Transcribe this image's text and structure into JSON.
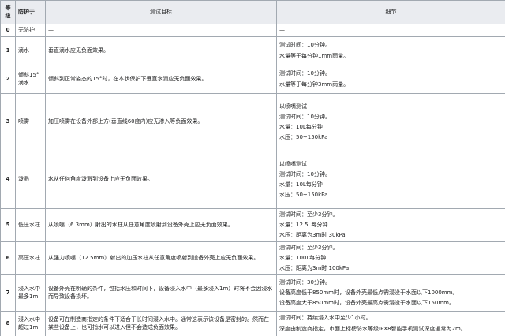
{
  "headers": {
    "level": "等级",
    "protect": "防护于",
    "target": "测试目标",
    "detail": "细节"
  },
  "rows": [
    {
      "level": "0",
      "protect": "无防护",
      "target": "—",
      "details": [
        "—"
      ]
    },
    {
      "level": "1",
      "protect": "滴水",
      "target": "垂直滴水应无负面效果。",
      "details": [
        "测试时间：10分钟。",
        "水量等于每分钟1mm雨量。"
      ]
    },
    {
      "level": "2",
      "protect": "倾斜15° 滴水",
      "target": "倾斜到正常姿态的15°时，在本状保护下垂直水滴应无负面效果。",
      "details": [
        "测试时间：10分钟。",
        "水量等于每分钟3mm雨量。"
      ]
    },
    {
      "level": "3",
      "protect": "喷雾",
      "target": "加压喷雾在设备外部上方(垂直线60度内)应无渗入等负面效果。",
      "details": [
        "以喷嘴测试",
        "测试时间：10分钟。",
        "水量：10L每分钟",
        "水压：50~150kPa"
      ]
    },
    {
      "level": "4",
      "protect": "泼溅",
      "target": "水从任何角度泼溅到设备上应无负面效果。",
      "details": [
        "以喷嘴测试",
        "测试时间：10分钟。",
        "水量：10L每分钟",
        "水压：50~150kPa"
      ]
    },
    {
      "level": "5",
      "protect": "低压水柱",
      "target": "从喷嘴（6.3mm）射出的水柱从任意角度喷射到设备外壳上应无负面效果。",
      "details": [
        "测试时间：至少3分钟。",
        "水量：12.5L每分钟",
        "水压：距离为3m时 30kPa"
      ]
    },
    {
      "level": "6",
      "protect": "高压水柱",
      "target": "从强力喷嘴（12.5mm）射出的加压水柱从任意角度喷射到设备外壳上应无负面效果。",
      "details": [
        "测试时间：至少3分钟。",
        "水量：100L每分钟",
        "水压：距离为3m时 100kPa"
      ]
    },
    {
      "level": "7",
      "protect": "浸入水中 最多1m",
      "target": "设备外壳在明确的条件，包括水压和时间下，设备浸入水中（最多浸入1m）时将不会因浸水而导致设备损坏。",
      "details": [
        "测试时间：30分钟。",
        "设备高度低于850mm时，设备外壳最低点需浸没于水面以下1000mm。",
        "设备高度大于850mm时，设备外壳最高点需浸没于水面以下150mm。"
      ]
    },
    {
      "level": "8",
      "protect": "浸入水中 超过1m",
      "target": "设备可在制造商指定的条件下适合于长时间浸入水中。通常这表示该设备是密封的。然而在某些设备上，也可指水可以进入但不会造成负面效果。",
      "details": [
        "测试时间：持续浸入水中至少1小时。",
        "深度由制造商指定，市面上标榜防水等级IPX8智能手机测试深度通常为2m。"
      ]
    }
  ]
}
